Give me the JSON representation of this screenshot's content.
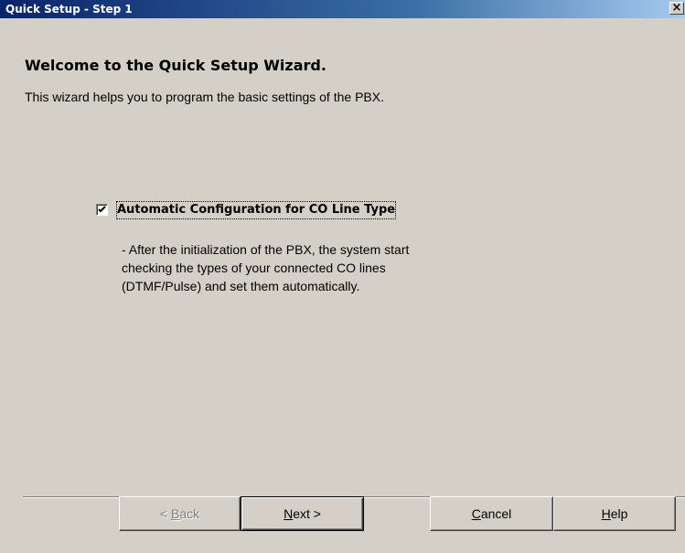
{
  "window": {
    "title": "Quick Setup - Step 1",
    "close_glyph": "×"
  },
  "main": {
    "heading": "Welcome to the Quick Setup Wizard.",
    "subtext": "This wizard helps you to program the basic settings of the PBX.",
    "checkbox": {
      "label": "Automatic Configuration for CO Line Type",
      "checked": true
    },
    "description_lines": [
      "- After the initialization of the PBX, the system start",
      "checking the types of your connected CO lines",
      "(DTMF/Pulse) and set them automatically."
    ]
  },
  "buttons": {
    "back": {
      "prefix": "< ",
      "mnemonic": "B",
      "rest": "ack",
      "enabled": false
    },
    "next": {
      "prefix": "",
      "mnemonic": "N",
      "rest": "ext >",
      "enabled": true
    },
    "cancel": {
      "prefix": "",
      "mnemonic": "C",
      "rest": "ancel",
      "enabled": true
    },
    "help": {
      "prefix": "",
      "mnemonic": "H",
      "rest": "elp",
      "enabled": true
    }
  },
  "colors": {
    "dialog_bg": "#d4d0c8",
    "titlebar_start": "#0a246a",
    "titlebar_end": "#a6caf0",
    "disabled_text": "#808080"
  },
  "icons": {
    "close": "close-icon",
    "check": "checkmark-icon"
  }
}
